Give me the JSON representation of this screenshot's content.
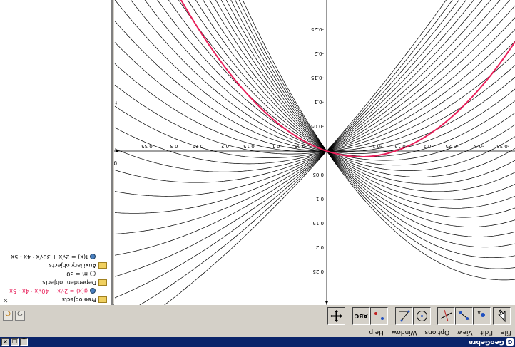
{
  "window": {
    "title": "GeoGebra",
    "app_icon": "geogebra-icon",
    "buttons": [
      "_",
      "□",
      "×"
    ]
  },
  "menu": [
    "File",
    "Edit",
    "View",
    "Options",
    "Window",
    "Help"
  ],
  "toolbar": {
    "tools": [
      {
        "name": "move-tool",
        "icon": "arrow-icon"
      },
      {
        "name": "point-tool",
        "icon": "point-icon"
      },
      {
        "name": "line-tool",
        "icon": "line-icon"
      },
      {
        "name": "perpendicular-tool",
        "icon": "perpendicular-icon"
      },
      {
        "name": "circle-tool",
        "icon": "circle-icon"
      },
      {
        "name": "angle-tool",
        "icon": "angle-icon"
      },
      {
        "name": "reflect-tool",
        "icon": "reflect-icon"
      },
      {
        "name": "text-tool",
        "label": "ABC"
      },
      {
        "name": "move-view-tool",
        "icon": "move-view-icon"
      }
    ],
    "undo_icon": "undo-icon",
    "redo_icon": "redo-icon"
  },
  "algebra": {
    "free_objects": "Free objects",
    "free_items": [
      {
        "text": "g(x) = 2√x + 40√x · 4x - 5x",
        "color": "#e8205a"
      }
    ],
    "dependent_objects": "Dependent objects",
    "dependent_items": [
      {
        "text": "m = 30"
      }
    ],
    "auxiliary_objects": "Auxiliary objects",
    "auxiliary_items": [
      {
        "text": "f(x) = 2√x + 30√x · 4x - 5x"
      }
    ]
  },
  "graphics": {
    "x_ticks": [
      "-0.4",
      "-0.35",
      "-0.3",
      "-0.25",
      "-0.2",
      "-0.15",
      "-0.1",
      "0.05",
      "0.1",
      "0.15",
      "0.2",
      "0.25",
      "0.3",
      "0.35"
    ],
    "y_ticks": [
      "0.25",
      "0.2",
      "0.15",
      "0.1",
      "0.05",
      "-0.05",
      "-0.1",
      "-0.15",
      "-0.2",
      "-0.25"
    ],
    "curve_label_f": "f",
    "curve_label_g": "g",
    "highlight_color": "#e8205a"
  }
}
